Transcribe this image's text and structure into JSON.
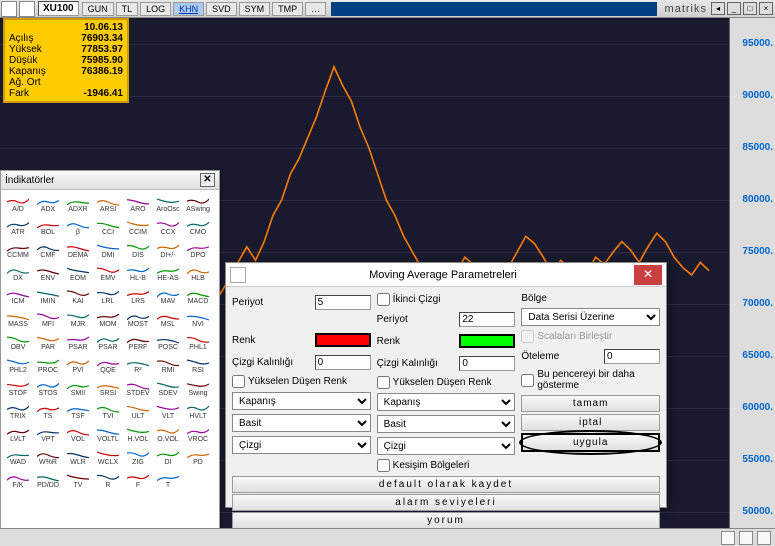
{
  "toolbar": {
    "symbol": "XU100",
    "tabs": [
      "GUN",
      "TL",
      "LOG",
      "KHN",
      "SVD",
      "SYM",
      "TMP"
    ],
    "active_tab": 3,
    "logo": "matriks"
  },
  "info": {
    "date": "10.06.13",
    "rows": [
      {
        "k": "Açılış",
        "v": "76903.34"
      },
      {
        "k": "Yüksek",
        "v": "77853.97"
      },
      {
        "k": "Düşük",
        "v": "75985.90"
      },
      {
        "k": "Kapanış",
        "v": "76386.19"
      },
      {
        "k": "Ağ. Ort",
        "v": ""
      },
      {
        "k": "Fark",
        "v": "-1946.41"
      }
    ]
  },
  "y_axis": [
    "95000.",
    "90000.",
    "85000.",
    "80000.",
    "75000.",
    "70000.",
    "65000.",
    "60000.",
    "55000.",
    "50000."
  ],
  "chart_data": {
    "type": "line",
    "title": "XU100",
    "ylim": [
      50000,
      95000
    ],
    "series": [
      {
        "name": "XU100",
        "color": "#ff7a00",
        "values": [
          60000,
          60500,
          61000,
          60800,
          62000,
          63500,
          62800,
          63000,
          64500,
          65000,
          64200,
          65500,
          66800,
          66000,
          67500,
          68000,
          67000,
          68500,
          69500,
          68800,
          70000,
          71500,
          72800,
          71000,
          72500,
          74000,
          75500,
          74200,
          76000,
          78500,
          80000,
          82500,
          84000,
          86000,
          88000,
          90500,
          92800,
          91000,
          89500,
          87000,
          85000,
          82500,
          80000,
          78500,
          76500,
          75000,
          73500,
          72000,
          70500,
          71500,
          73000,
          74500,
          73800,
          72500,
          71000,
          72000,
          73500,
          75000,
          76500,
          75800,
          74500,
          73000,
          74200,
          73500,
          72000,
          73000,
          74500,
          73800,
          75000,
          76000,
          75200,
          74000,
          75500,
          76800,
          76000,
          74500,
          73500,
          72800,
          74000,
          73200
        ]
      }
    ]
  },
  "indicators": {
    "title": "İndikatörler",
    "items": [
      "A/D",
      "ADX",
      "ADXR",
      "ARSI",
      "ARO",
      "AroOsc",
      "ASwing",
      "ATR",
      "BOL",
      "β",
      "CCI",
      "CCIM",
      "CCX",
      "CMO",
      "CCMM",
      "CMF",
      "DEMA",
      "DMI",
      "DIS",
      "DI+/-",
      "DPO",
      "DX",
      "ENV",
      "EOM",
      "EMV",
      "HL-B",
      "HE-AS",
      "HLB",
      "ICM",
      "IMIN",
      "KAI",
      "LRL",
      "LRS",
      "MAV",
      "MACD",
      "MASS",
      "MFI",
      "MJR",
      "MOM",
      "MOST",
      "MSL",
      "NVI",
      "OBV",
      "PAR",
      "PSAR",
      "PSAR",
      "PERF",
      "POSC",
      "PHL1",
      "PHL2",
      "PROC",
      "PVI",
      "QQE",
      "R²",
      "RMI",
      "RSI",
      "STOF",
      "STOS",
      "SMII",
      "SRSI",
      "STDEV",
      "SDEV",
      "Swing",
      "TRIX",
      "TS",
      "TSF",
      "TVI",
      "ULT",
      "VLT",
      "HVLT",
      "LVLT",
      "VPT",
      "VOL",
      "VOLTL",
      "H.VOL",
      "O.VOL",
      "VROC",
      "WAD",
      "W%R",
      "WLR",
      "WCLX",
      "ZIG",
      "DI",
      "PD",
      "F/K",
      "PD/DD",
      "TV",
      "R",
      "F",
      "T"
    ]
  },
  "dialog": {
    "title": "Moving Average Parametreleri",
    "col1": {
      "period_label": "Periyot",
      "period_value": "5",
      "renk_label": "Renk",
      "renk_color": "#ff0000",
      "kalinlik_label": "Çizgi Kalınlığı",
      "kalinlik_value": "0",
      "yuk_chk": "Yükselen Düşen Renk",
      "sel1": "Kapanış",
      "sel2": "Basit",
      "sel3": "Çizgi"
    },
    "col2": {
      "ikinci_chk": "İkinci Çizgi",
      "period_label": "Periyot",
      "period_value": "22",
      "renk_label": "Renk",
      "renk_color": "#00ff00",
      "kalinlik_label": "Çizgi Kalınlığı",
      "kalinlik_value": "0",
      "yuk_chk": "Yükselen Düşen Renk",
      "sel1": "Kapanış",
      "sel2": "Basit",
      "sel3": "Çizgi",
      "kesisim_chk": "Kesişim Bölgeleri"
    },
    "col3": {
      "bolge_label": "Bölge",
      "bolge_sel": "Data Serisi Üzerine",
      "scala_chk": "Scalaları Birleştir",
      "oteleme_label": "Öteleme",
      "oteleme_value": "0",
      "gosterme_chk": "Bu pencereyi bir daha gösterme",
      "btn_tamam": "tamam",
      "btn_iptal": "iptal",
      "btn_uygula": "uygula"
    },
    "wide_btns": [
      "default olarak kaydet",
      "alarm seviyeleri",
      "yorum"
    ]
  }
}
